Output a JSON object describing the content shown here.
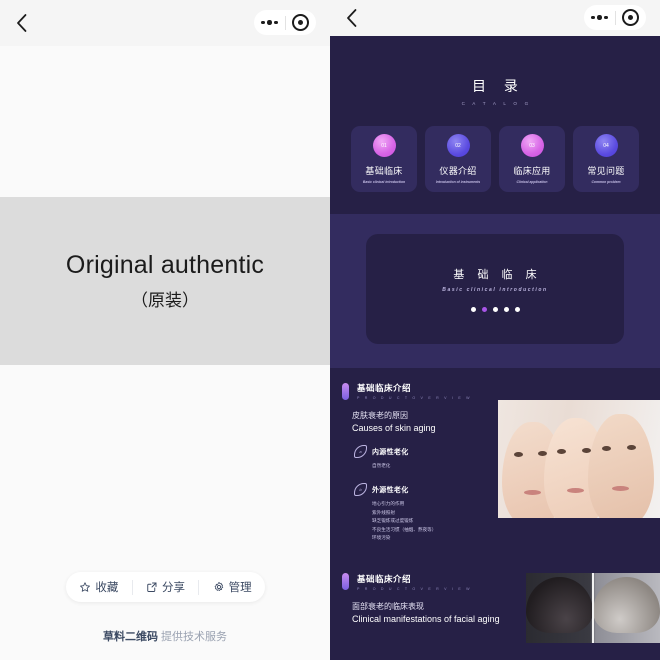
{
  "left_panel": {
    "nav": {
      "back_icon": "chevron-left-icon",
      "menu_icon": "more-dots-icon",
      "target_icon": "target-circle-icon"
    },
    "banner": {
      "english": "Original authentic",
      "chinese": "（原装）"
    },
    "actions": [
      {
        "icon": "star-icon",
        "label": "收藏"
      },
      {
        "icon": "share-icon",
        "label": "分享"
      },
      {
        "icon": "gear-icon",
        "label": "管理"
      }
    ],
    "footer": {
      "brand": "草料二维码",
      "suffix": " 提供技术服务"
    }
  },
  "right_panel": {
    "nav": {
      "back_icon": "chevron-left-icon",
      "menu_icon": "more-dots-icon",
      "target_icon": "target-circle-icon"
    },
    "catalog": {
      "title": "目 录",
      "subtitle": "C A T A L O G",
      "cards": [
        {
          "num": "01",
          "cn": "基础临床",
          "en": "Basic clinical introduction",
          "color": "pink"
        },
        {
          "num": "02",
          "cn": "仪器介绍",
          "en": "Introduction of instruments",
          "color": "blue"
        },
        {
          "num": "03",
          "cn": "临床应用",
          "en": "Clinical application",
          "color": "pink"
        },
        {
          "num": "04",
          "cn": "常见问题",
          "en": "Common problem",
          "color": "blue"
        }
      ]
    },
    "hero": {
      "title": "基 础 临 床",
      "subtitle": "Basic clinical introduction",
      "dot_count": 5,
      "active_dot": 2
    },
    "section_1": {
      "tag_cn": "基础临床介绍",
      "tag_en": "P R O D U C T   O V E R V I E W",
      "heading_cn": "皮肤衰老的原因",
      "heading_en": "Causes of skin aging",
      "items": [
        {
          "mark": "a",
          "title": "内源性老化",
          "bullets": [
            "自然老化"
          ]
        },
        {
          "mark": "b",
          "title": "外源性老化",
          "bullets": [
            "地心引力的作用",
            "紫外线照射",
            "缺乏锻炼或过度锻炼",
            "不良生活习惯（抽烟、熬夜等）",
            "环境污染"
          ]
        }
      ],
      "image_alt": "skin-aging-progression-photo"
    },
    "section_2": {
      "tag_cn": "基础临床介绍",
      "tag_en": "P R O D U C T   O V E R V I E W",
      "heading_cn": "面部衰老的临床表现",
      "heading_en": "Clinical manifestations of facial aging",
      "image_alt": "hair-graying-before-after-photo"
    }
  },
  "colors": {
    "navy_dark": "#262046",
    "navy_mid": "#332c5f",
    "accent_pink": "#d765e6",
    "accent_blue": "#5a4ae0",
    "accent_purple": "#a855e8",
    "banner_gray": "#dcdcdc",
    "left_bg": "#fafafa"
  }
}
